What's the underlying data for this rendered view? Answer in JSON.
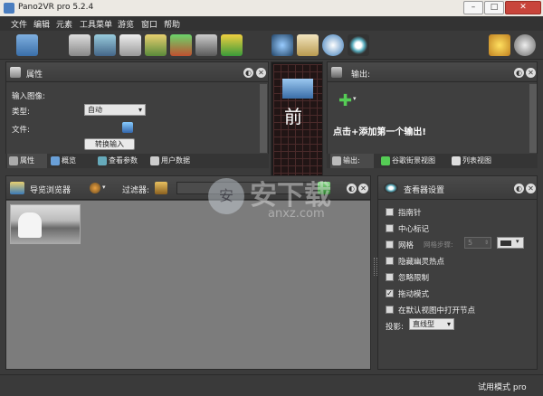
{
  "app": {
    "title": "Pano2VR pro 5.2.4"
  },
  "menu": [
    "文件",
    "编辑",
    "元素",
    "工具菜单",
    "游览",
    "窗口",
    "帮助"
  ],
  "toolbar_icons": [
    "import-icon",
    "tour-map-icon",
    "tour-browser-icon",
    "slideshow-icon",
    "patch-icon",
    "tour-image-icon",
    "map-icon",
    "hotspot-icon",
    "binoculars-icon",
    "clipboard-icon",
    "clock-icon",
    "eye-icon",
    "star-icon",
    "film-icon"
  ],
  "properties": {
    "header": "属性",
    "input_image_label": "输入图像:",
    "type_label": "类型:",
    "type_value": "自动",
    "file_label": "文件:",
    "convert_button": "转换输入",
    "tabs": [
      "属性",
      "概览",
      "查看参数",
      "用户数据"
    ]
  },
  "preview": {
    "face_label": "前"
  },
  "output": {
    "header": "输出:",
    "add_output_text": "点击+添加第一个输出!",
    "tabs": [
      "输出:",
      "谷歌街景视图",
      "列表视图"
    ]
  },
  "tour_browser": {
    "header": "导览浏览器",
    "filter_label": "过滤器:"
  },
  "viewer_settings": {
    "header": "查看器设置",
    "options": [
      {
        "label": "指南针",
        "checked": false
      },
      {
        "label": "中心标记",
        "checked": false
      },
      {
        "label": "网格",
        "checked": false
      },
      {
        "label": "隐藏幽灵热点",
        "checked": false
      },
      {
        "label": "忽略限制",
        "checked": false
      },
      {
        "label": "拖动模式",
        "checked": true
      },
      {
        "label": "在默认视图中打开节点",
        "checked": false
      }
    ],
    "grid_steps_label": "网格步骤:",
    "grid_steps_value": "5",
    "projection_label": "投影:",
    "projection_value": "直线型"
  },
  "status": {
    "mode": "试用模式 pro"
  },
  "watermark": {
    "text": "安下载",
    "url": "anxz.com"
  }
}
